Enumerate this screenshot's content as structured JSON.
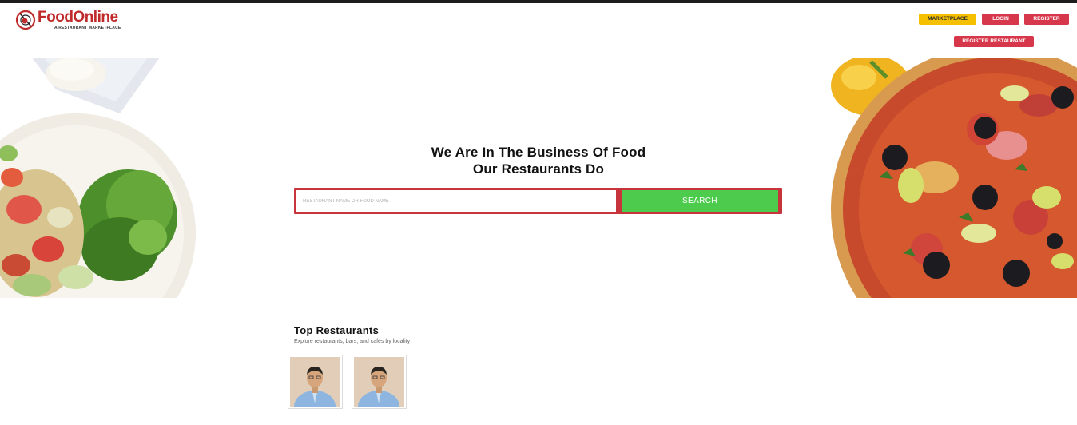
{
  "brand": {
    "name": "FoodOnline",
    "tagline": "A RESTAURANT MARKETPLACE",
    "logo_color": "#c02a2a"
  },
  "nav": {
    "marketplace": "MARKETPLACE",
    "login": "LOGIN",
    "register": "REGISTER",
    "register_restaurant": "REGISTER RESTAURANT"
  },
  "hero": {
    "title_line1": "We Are In The Business Of Food",
    "title_line2": "Our Restaurants Do",
    "search": {
      "placeholder": "RESTAURANT NAME OR FOOD NAME",
      "value": "",
      "button_label": "SEARCH"
    }
  },
  "top_restaurants": {
    "title": "Top Restaurants",
    "subtitle": "Explore restaurants, bars, and cafés by locality",
    "cards": [
      {
        "image": "restaurant-owner-photo"
      },
      {
        "image": "restaurant-owner-photo"
      }
    ]
  },
  "colors": {
    "accent_red": "#d7374a",
    "search_border": "#c8343c",
    "search_button": "#4ccb4c",
    "marketplace_button": "#f5c000"
  }
}
